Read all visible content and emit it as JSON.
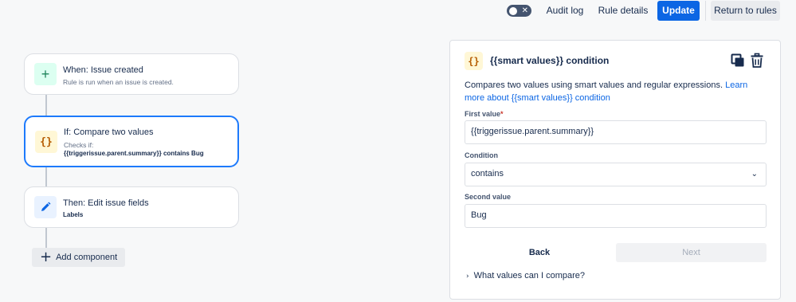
{
  "topbar": {
    "toggle_icon": "close-icon",
    "audit_log": "Audit log",
    "rule_details": "Rule details",
    "update": "Update",
    "return_to_rules": "Return to rules",
    "accent_color": "#0c66e4"
  },
  "flow": {
    "trigger": {
      "icon": "plus-icon",
      "title": "When: Issue created",
      "subtitle": "Rule is run when an issue is created."
    },
    "condition": {
      "icon": "braces-icon",
      "icon_text": "{}",
      "title": "If: Compare two values",
      "subtitle": "Checks if:",
      "detail": "{{triggerissue.parent.summary}} contains Bug"
    },
    "action": {
      "icon": "pencil-icon",
      "title": "Then: Edit issue fields",
      "detail": "Labels"
    },
    "add_component": "Add component"
  },
  "panel": {
    "icon_text": "{}",
    "title": "{{smart values}} condition",
    "copy_icon": "duplicate-icon",
    "delete_icon": "trash-icon",
    "description": "Compares two values using smart values and regular expressions.",
    "learn_more": "Learn more about {{smart values}} condition",
    "first_value_label": "First value",
    "required_marker": "*",
    "first_value": "{{triggerissue.parent.summary}}",
    "condition_label": "Condition",
    "condition_value": "contains",
    "second_value_label": "Second value",
    "second_value": "Bug",
    "back": "Back",
    "next": "Next",
    "faq": "What values can I compare?"
  }
}
